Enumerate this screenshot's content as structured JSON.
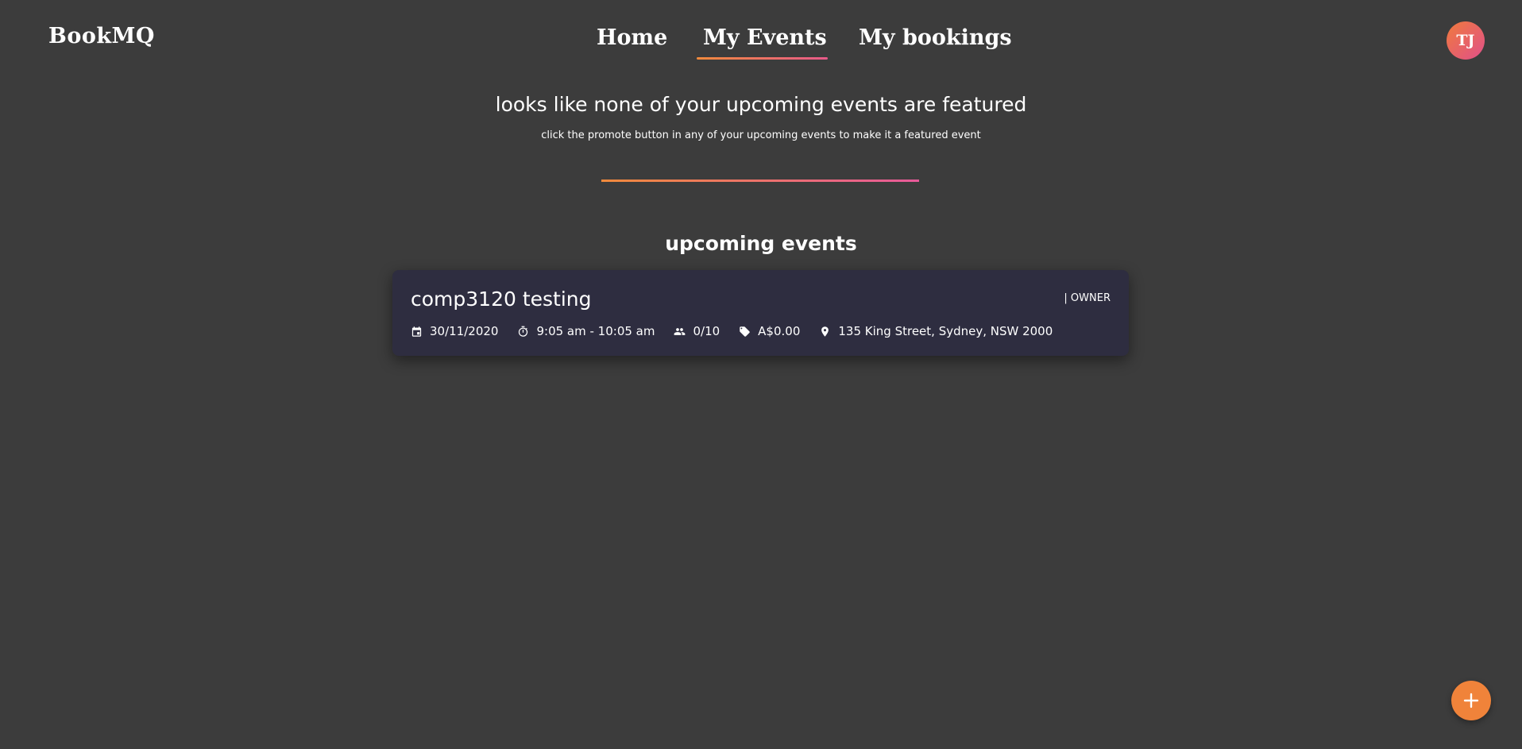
{
  "app": {
    "logo": "BookMQ"
  },
  "nav": {
    "items": [
      {
        "label": "Home",
        "active": false
      },
      {
        "label": "My Events",
        "active": true
      },
      {
        "label": "My bookings",
        "active": false
      }
    ]
  },
  "user": {
    "initials": "TJ"
  },
  "featured": {
    "title": "looks like none of your upcoming events are featured",
    "subtitle": "click the promote button in any of your upcoming events to make it a featured event"
  },
  "upcoming": {
    "title": "upcoming events",
    "events": [
      {
        "name": "comp3120 testing",
        "role": "| OWNER",
        "date": "30/11/2020",
        "time": "9:05 am - 10:05 am",
        "attendance": "0/10",
        "price": "A$0.00",
        "location": "135 King Street, Sydney, NSW 2000"
      }
    ]
  },
  "colors": {
    "background": "#3c3c3c",
    "card": "#2e2d40",
    "accent_orange": "#f08a3c",
    "accent_pink": "#e85a8a"
  },
  "icons": [
    "calendar-icon",
    "timer-icon",
    "people-icon",
    "price-tag-icon",
    "location-pin-icon",
    "plus-icon"
  ]
}
